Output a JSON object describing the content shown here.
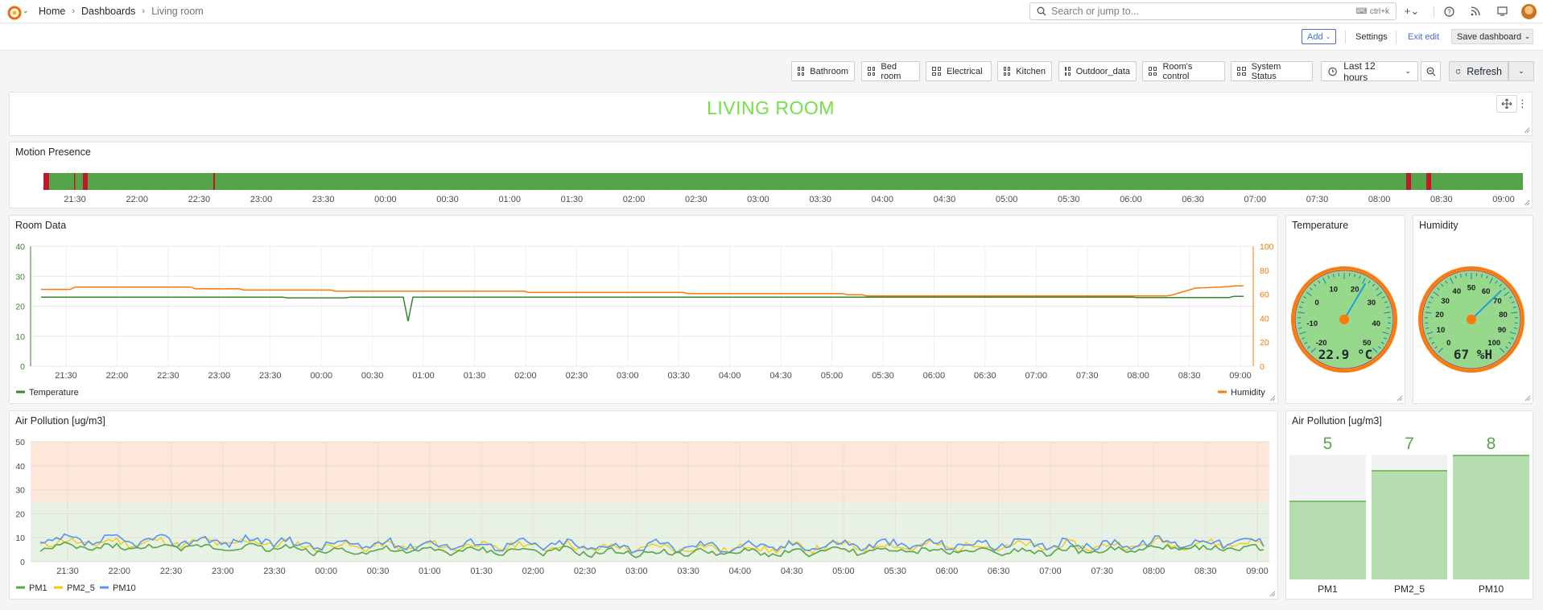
{
  "breadcrumb": {
    "home": "Home",
    "dashboards": "Dashboards",
    "current": "Living room"
  },
  "search": {
    "placeholder": "Search or jump to...",
    "shortcut": "ctrl+k"
  },
  "toolbar": {
    "add": "Add",
    "settings": "Settings",
    "exit_edit": "Exit edit",
    "save": "Save dashboard"
  },
  "dashboard_links": [
    "Bathroom",
    "Bed room",
    "Electrical",
    "Kitchen",
    "Outdoor_data",
    "Room's control",
    "System Status"
  ],
  "time_range": "Last 12 hours",
  "refresh": "Refresh",
  "title_panel": {
    "text": "LIVING ROOM"
  },
  "motion_panel": {
    "title": "Motion Presence",
    "time_ticks": [
      "21:30",
      "22:00",
      "22:30",
      "23:00",
      "23:30",
      "00:00",
      "00:30",
      "01:00",
      "01:30",
      "02:00",
      "02:30",
      "03:00",
      "03:30",
      "04:00",
      "04:30",
      "05:00",
      "05:30",
      "06:00",
      "06:30",
      "07:00",
      "07:30",
      "08:00",
      "08:30",
      "09:00"
    ]
  },
  "room_panel": {
    "title": "Room Data",
    "left_ticks": [
      "0",
      "10",
      "20",
      "30",
      "40"
    ],
    "right_ticks": [
      "0",
      "20",
      "40",
      "60",
      "80",
      "100"
    ],
    "time_ticks": [
      "21:30",
      "22:00",
      "22:30",
      "23:00",
      "23:30",
      "00:00",
      "00:30",
      "01:00",
      "01:30",
      "02:00",
      "02:30",
      "03:00",
      "03:30",
      "04:00",
      "04:30",
      "05:00",
      "05:30",
      "06:00",
      "06:30",
      "07:00",
      "07:30",
      "08:00",
      "08:30",
      "09:00"
    ],
    "legend_left": "Temperature",
    "legend_right": "Humidity",
    "colors": {
      "temperature": "#37872d",
      "humidity": "#ff780a"
    }
  },
  "temp_gauge": {
    "title": "Temperature",
    "value": "22.9 °C",
    "numeric": 22.9,
    "ticks": [
      "-20",
      "-10",
      "0",
      "10",
      "20",
      "30",
      "40",
      "50"
    ]
  },
  "hum_gauge": {
    "title": "Humidity",
    "value": "67 %H",
    "numeric": 67,
    "ticks": [
      "0",
      "10",
      "20",
      "30",
      "40",
      "50",
      "60",
      "70",
      "80",
      "90",
      "100"
    ]
  },
  "air_panel": {
    "title": "Air Pollution [ug/m3]",
    "y_ticks": [
      "0",
      "10",
      "20",
      "30",
      "40",
      "50"
    ],
    "time_ticks": [
      "21:30",
      "22:00",
      "22:30",
      "23:00",
      "23:30",
      "00:00",
      "00:30",
      "01:00",
      "01:30",
      "02:00",
      "02:30",
      "03:00",
      "03:30",
      "04:00",
      "04:30",
      "05:00",
      "05:30",
      "06:00",
      "06:30",
      "07:00",
      "07:30",
      "08:00",
      "08:30",
      "09:00"
    ],
    "legend": [
      "PM1",
      "PM2_5",
      "PM10"
    ],
    "colors": {
      "PM1": "#56a64b",
      "PM2_5": "#f2cc0c",
      "PM10": "#5794f2"
    }
  },
  "bar_panel": {
    "title": "Air Pollution [ug/m3]",
    "bars": [
      {
        "label": "PM1",
        "value": "5",
        "fraction": 0.63
      },
      {
        "label": "PM2_5",
        "value": "7",
        "fraction": 0.88
      },
      {
        "label": "PM10",
        "value": "8",
        "fraction": 1.0
      }
    ]
  }
}
